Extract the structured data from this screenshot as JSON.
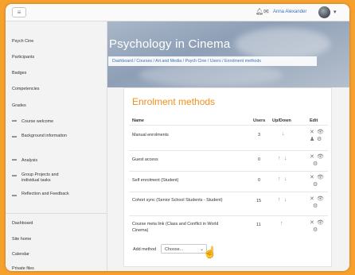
{
  "topbar": {
    "menu_icon": "hamburger-icon",
    "notifications_icon": "bell-icon",
    "messages_icon": "chat-icon",
    "user_name": "Anna Alexander",
    "menu_caret": "▾"
  },
  "sidebar": {
    "nav": [
      "Psych Cine",
      "Participants",
      "Badges",
      "Competencies",
      "Grades"
    ],
    "sections": [
      {
        "label": "Course welcome"
      },
      {
        "label": "Background information"
      },
      {
        "label": "Analysis"
      },
      {
        "label": "Group Projects and individual tasks"
      },
      {
        "label": "Reflection and Feedback"
      }
    ],
    "bottom": [
      "Dashboard",
      "Site home",
      "Calendar",
      "Private files"
    ]
  },
  "hero": {
    "title": "Psychology in Cinema",
    "breadcrumb": "Dashboard / Courses / Art and Media / Psych Cine / Users / Enrolment methods"
  },
  "main": {
    "title": "Enrolment methods",
    "columns": [
      "Name",
      "Users",
      "Up/Down",
      "Edit"
    ],
    "rows": [
      {
        "name": "Manual enrolments",
        "users": "3"
      },
      {
        "name": "Guest access",
        "users": "0"
      },
      {
        "name": "Self enrolment (Student)",
        "users": "0"
      },
      {
        "name": "Cohort sync (Senior School Students - Student)",
        "users": "15"
      },
      {
        "name": "Course meta link (Class and Conflict in World Cinema)",
        "users": "11"
      }
    ],
    "add_method_label": "Add method",
    "add_method_value": "Choose..."
  },
  "colors": {
    "accent": "#f18f1f",
    "background": "#f6a02e",
    "link": "#3a72b5"
  }
}
